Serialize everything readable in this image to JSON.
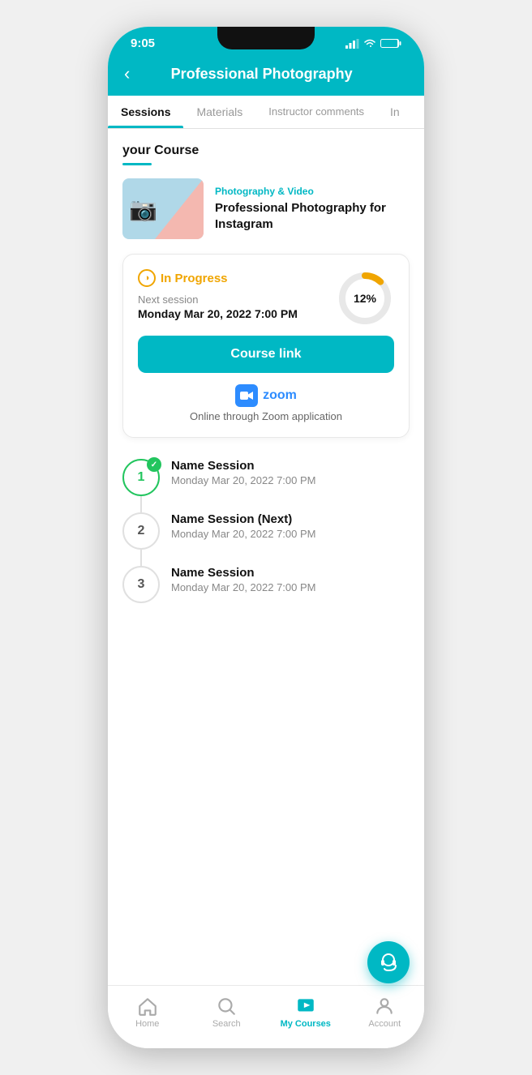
{
  "statusBar": {
    "time": "9:05",
    "icons": "signal wifi battery"
  },
  "header": {
    "backLabel": "‹",
    "title": "Professional Photography"
  },
  "tabs": [
    {
      "id": "sessions",
      "label": "Sessions",
      "active": true
    },
    {
      "id": "materials",
      "label": "Materials",
      "active": false
    },
    {
      "id": "instructor-comments",
      "label": "Instructor comments",
      "active": false
    },
    {
      "id": "info",
      "label": "In",
      "active": false
    }
  ],
  "sectionTitle": "your Course",
  "course": {
    "category": "Photography & Video",
    "name": "Professional Photography for Instagram"
  },
  "progressCard": {
    "statusLabel": "In Progress",
    "nextSessionLabel": "Next session",
    "nextSessionDate": "Monday Mar 20, 2022 7:00 PM",
    "progressPercent": 12,
    "progressLabel": "12%"
  },
  "courseLink": {
    "label": "Course link"
  },
  "zoom": {
    "name": "zoom",
    "description": "Online through Zoom application"
  },
  "sessions": [
    {
      "number": "1",
      "completed": true,
      "name": "Name Session",
      "date": "Monday Mar 20, 2022 7:00 PM",
      "isNext": false
    },
    {
      "number": "2",
      "completed": false,
      "name": "Name Session",
      "nextLabel": "(Next)",
      "date": "Monday Mar 20, 2022 7:00 PM",
      "isNext": true
    },
    {
      "number": "3",
      "completed": false,
      "name": "Name Session",
      "date": "Monday Mar 20, 2022 7:00 PM",
      "isNext": false
    }
  ],
  "bottomNav": [
    {
      "id": "home",
      "label": "Home",
      "active": false,
      "icon": "home"
    },
    {
      "id": "search",
      "label": "Search",
      "active": false,
      "icon": "search"
    },
    {
      "id": "my-courses",
      "label": "My Courses",
      "active": true,
      "icon": "mycourses"
    },
    {
      "id": "account",
      "label": "Account",
      "active": false,
      "icon": "account"
    }
  ],
  "fab": {
    "icon": "headset"
  }
}
